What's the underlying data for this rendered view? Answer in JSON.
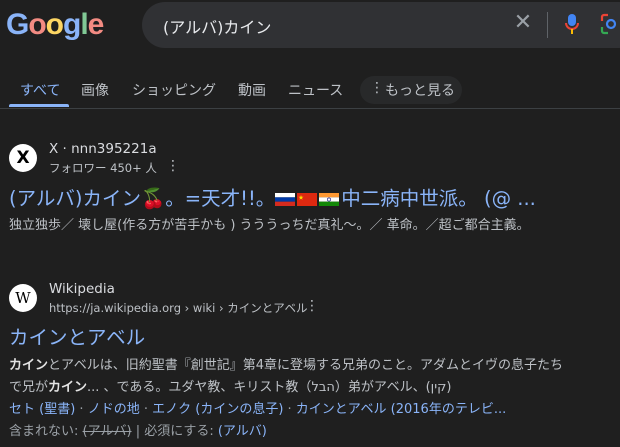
{
  "header": {
    "logo_letters": [
      "G",
      "o",
      "o",
      "g",
      "l",
      "e"
    ],
    "query": "(アルバ)カイン",
    "clear_label": "✕"
  },
  "tabs": [
    {
      "label": "すべて",
      "active": true
    },
    {
      "label": "画像"
    },
    {
      "label": "ショッピング"
    },
    {
      "label": "動画"
    },
    {
      "label": "ニュース"
    },
    {
      "label": "もっと見る",
      "icon": "more-vert-icon"
    }
  ],
  "results": [
    {
      "favicon_letter": "X",
      "site_name": "X · nnn395221a",
      "site_sub": "フォロワー 450+ 人",
      "title_part1": "(アルバ)カイン🍒。=天才!!。",
      "title_part2": "中二病中世派。 (@ ...",
      "flags": [
        "russia-flag",
        "china-flag",
        "india-flag"
      ],
      "snippet_lines": [
        "独立独歩／ 壊し屋(作る方が苦手かも ) うううっちだ真礼〜。／ 革命。／超ご都合主義。"
      ]
    },
    {
      "favicon_letter": "W",
      "site_name": "Wikipedia",
      "site_sub": "https://ja.wikipedia.org › wiki › カインとアベル",
      "title": "カインとアベル",
      "snippet_bold1": "カイン",
      "snippet_line1_rest": "とアベルは、旧約聖書『創世記』第4章に登場する兄弟のこと。アダムとイヴの息子たち",
      "snippet_line2_pre": "で兄が",
      "snippet_bold2": "カイン",
      "snippet_line2_rest": "... 、である。ユダヤ教、キリスト教（הבל）弟がアベル、(קין)",
      "sublinks": [
        "セト (聖書)",
        "ノドの地",
        "エノク (カインの息子)",
        "カインとアベル (2016年のテレビ..."
      ],
      "missing_label": "含まれない:",
      "missing_term": "(アルバ)",
      "must_include_label": "| 必須にする:",
      "must_include_term": "(アルバ)"
    }
  ],
  "colors": {
    "background": "#1f1f1f",
    "link": "#8ab4f8",
    "text": "#bdc1c6"
  }
}
